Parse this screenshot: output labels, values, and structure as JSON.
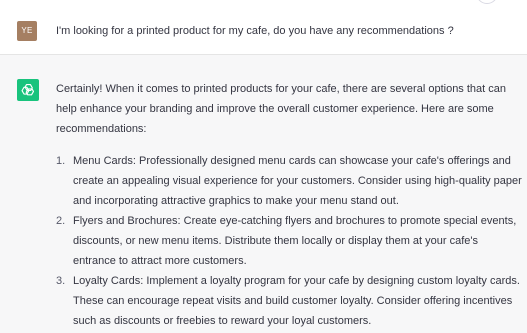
{
  "user_message": {
    "avatar_initials": "YE",
    "avatar_color": "#a57f62",
    "text": "I'm looking for a printed product for my cafe, do you have any recommendations ?"
  },
  "assistant_message": {
    "avatar_icon": "openai-logo-icon",
    "avatar_color": "#19c37d",
    "intro": "Certainly! When it comes to printed products for your cafe, there are several options that can help enhance your branding and improve the overall customer experience. Here are some recommendations:",
    "items": [
      {
        "number": "1.",
        "text": "Menu Cards: Professionally designed menu cards can showcase your cafe's offerings and create an appealing visual experience for your customers. Consider using high-quality paper and incorporating attractive graphics to make your menu stand out."
      },
      {
        "number": "2.",
        "text": "Flyers and Brochures: Create eye-catching flyers and brochures to promote special events, discounts, or new menu items. Distribute them locally or display them at your cafe's entrance to attract more customers."
      },
      {
        "number": "3.",
        "text": "Loyalty Cards: Implement a loyalty program for your cafe by designing custom loyalty cards. These can encourage repeat visits and build customer loyalty. Consider offering incentives such as discounts or freebies to reward your loyal customers."
      }
    ]
  }
}
